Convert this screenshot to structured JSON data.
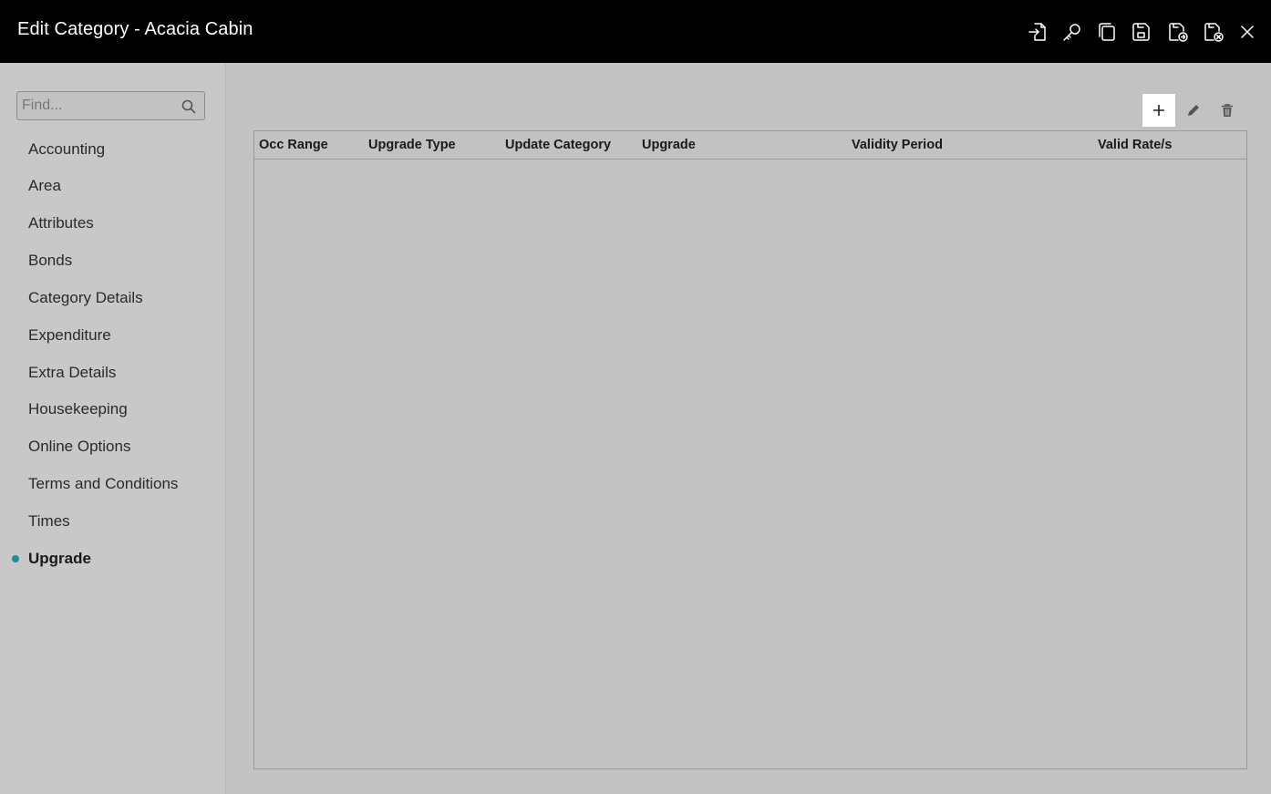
{
  "window": {
    "title": "Edit Category - Acacia Cabin",
    "toolbar_icons": [
      "login-icon",
      "key-icon",
      "copy-icon",
      "save-icon",
      "save-and-go-icon",
      "save-and-close-icon",
      "close-icon"
    ]
  },
  "sidebar": {
    "search": {
      "placeholder": "Find...",
      "value": ""
    },
    "items": [
      {
        "label": "Accounting"
      },
      {
        "label": "Area"
      },
      {
        "label": "Attributes"
      },
      {
        "label": "Bonds"
      },
      {
        "label": "Category Details"
      },
      {
        "label": "Expenditure"
      },
      {
        "label": "Extra Details"
      },
      {
        "label": "Housekeeping"
      },
      {
        "label": "Online Options"
      },
      {
        "label": "Terms and Conditions"
      },
      {
        "label": "Times"
      },
      {
        "label": "Upgrade",
        "active": true
      }
    ],
    "active_color": "#1a8f9a"
  },
  "main": {
    "actions": [
      "add-icon",
      "edit-icon",
      "delete-icon"
    ],
    "table": {
      "columns": [
        {
          "label": "Occ Range"
        },
        {
          "label": "Upgrade Type"
        },
        {
          "label": "Update Category"
        },
        {
          "label": "Upgrade"
        },
        {
          "label": "Validity Period"
        },
        {
          "label": "Valid Rate/s"
        }
      ],
      "rows": []
    }
  }
}
